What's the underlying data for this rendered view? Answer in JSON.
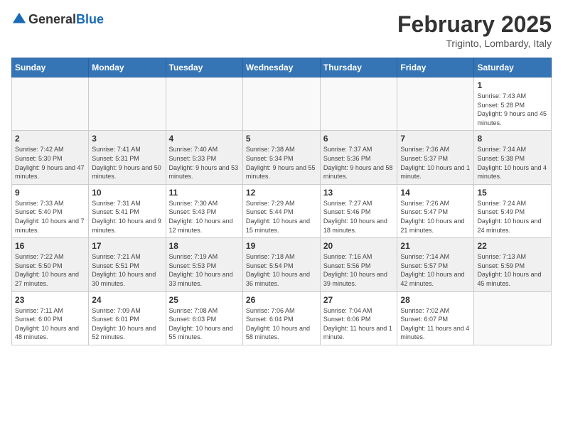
{
  "logo": {
    "general": "General",
    "blue": "Blue"
  },
  "header": {
    "month": "February 2025",
    "location": "Triginto, Lombardy, Italy"
  },
  "weekdays": [
    "Sunday",
    "Monday",
    "Tuesday",
    "Wednesday",
    "Thursday",
    "Friday",
    "Saturday"
  ],
  "weeks": [
    [
      {
        "day": "",
        "info": ""
      },
      {
        "day": "",
        "info": ""
      },
      {
        "day": "",
        "info": ""
      },
      {
        "day": "",
        "info": ""
      },
      {
        "day": "",
        "info": ""
      },
      {
        "day": "",
        "info": ""
      },
      {
        "day": "1",
        "info": "Sunrise: 7:43 AM\nSunset: 5:28 PM\nDaylight: 9 hours and 45 minutes."
      }
    ],
    [
      {
        "day": "2",
        "info": "Sunrise: 7:42 AM\nSunset: 5:30 PM\nDaylight: 9 hours and 47 minutes."
      },
      {
        "day": "3",
        "info": "Sunrise: 7:41 AM\nSunset: 5:31 PM\nDaylight: 9 hours and 50 minutes."
      },
      {
        "day": "4",
        "info": "Sunrise: 7:40 AM\nSunset: 5:33 PM\nDaylight: 9 hours and 53 minutes."
      },
      {
        "day": "5",
        "info": "Sunrise: 7:38 AM\nSunset: 5:34 PM\nDaylight: 9 hours and 55 minutes."
      },
      {
        "day": "6",
        "info": "Sunrise: 7:37 AM\nSunset: 5:36 PM\nDaylight: 9 hours and 58 minutes."
      },
      {
        "day": "7",
        "info": "Sunrise: 7:36 AM\nSunset: 5:37 PM\nDaylight: 10 hours and 1 minute."
      },
      {
        "day": "8",
        "info": "Sunrise: 7:34 AM\nSunset: 5:38 PM\nDaylight: 10 hours and 4 minutes."
      }
    ],
    [
      {
        "day": "9",
        "info": "Sunrise: 7:33 AM\nSunset: 5:40 PM\nDaylight: 10 hours and 7 minutes."
      },
      {
        "day": "10",
        "info": "Sunrise: 7:31 AM\nSunset: 5:41 PM\nDaylight: 10 hours and 9 minutes."
      },
      {
        "day": "11",
        "info": "Sunrise: 7:30 AM\nSunset: 5:43 PM\nDaylight: 10 hours and 12 minutes."
      },
      {
        "day": "12",
        "info": "Sunrise: 7:29 AM\nSunset: 5:44 PM\nDaylight: 10 hours and 15 minutes."
      },
      {
        "day": "13",
        "info": "Sunrise: 7:27 AM\nSunset: 5:46 PM\nDaylight: 10 hours and 18 minutes."
      },
      {
        "day": "14",
        "info": "Sunrise: 7:26 AM\nSunset: 5:47 PM\nDaylight: 10 hours and 21 minutes."
      },
      {
        "day": "15",
        "info": "Sunrise: 7:24 AM\nSunset: 5:49 PM\nDaylight: 10 hours and 24 minutes."
      }
    ],
    [
      {
        "day": "16",
        "info": "Sunrise: 7:22 AM\nSunset: 5:50 PM\nDaylight: 10 hours and 27 minutes."
      },
      {
        "day": "17",
        "info": "Sunrise: 7:21 AM\nSunset: 5:51 PM\nDaylight: 10 hours and 30 minutes."
      },
      {
        "day": "18",
        "info": "Sunrise: 7:19 AM\nSunset: 5:53 PM\nDaylight: 10 hours and 33 minutes."
      },
      {
        "day": "19",
        "info": "Sunrise: 7:18 AM\nSunset: 5:54 PM\nDaylight: 10 hours and 36 minutes."
      },
      {
        "day": "20",
        "info": "Sunrise: 7:16 AM\nSunset: 5:56 PM\nDaylight: 10 hours and 39 minutes."
      },
      {
        "day": "21",
        "info": "Sunrise: 7:14 AM\nSunset: 5:57 PM\nDaylight: 10 hours and 42 minutes."
      },
      {
        "day": "22",
        "info": "Sunrise: 7:13 AM\nSunset: 5:59 PM\nDaylight: 10 hours and 45 minutes."
      }
    ],
    [
      {
        "day": "23",
        "info": "Sunrise: 7:11 AM\nSunset: 6:00 PM\nDaylight: 10 hours and 48 minutes."
      },
      {
        "day": "24",
        "info": "Sunrise: 7:09 AM\nSunset: 6:01 PM\nDaylight: 10 hours and 52 minutes."
      },
      {
        "day": "25",
        "info": "Sunrise: 7:08 AM\nSunset: 6:03 PM\nDaylight: 10 hours and 55 minutes."
      },
      {
        "day": "26",
        "info": "Sunrise: 7:06 AM\nSunset: 6:04 PM\nDaylight: 10 hours and 58 minutes."
      },
      {
        "day": "27",
        "info": "Sunrise: 7:04 AM\nSunset: 6:06 PM\nDaylight: 11 hours and 1 minute."
      },
      {
        "day": "28",
        "info": "Sunrise: 7:02 AM\nSunset: 6:07 PM\nDaylight: 11 hours and 4 minutes."
      },
      {
        "day": "",
        "info": ""
      }
    ]
  ]
}
